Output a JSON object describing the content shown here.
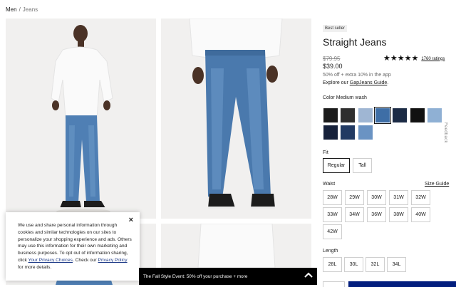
{
  "breadcrumb": {
    "parent": "Men",
    "separator": "/",
    "current": "Jeans"
  },
  "cookie_banner": {
    "text_before": "We use and share personal information through cookies and similar technologies on our sites to personalize your shopping experience and ads. Others may use this information for their own marketing and business purposes. To opt out of information sharing, click ",
    "link1": "Your Privacy Choices",
    "text_middle": ". Check our ",
    "link2": "Privacy Policy",
    "text_after": " for more details.",
    "close": "×"
  },
  "promo": {
    "text": "The Fall Style Event: 50% off your purchase + more"
  },
  "product": {
    "badge": "Best seller",
    "title": "Straight Jeans",
    "old_price": "$79.95",
    "price": "$39.00",
    "rating_stars": "★★★★★",
    "rating_value": 5,
    "ratings_count": "1760 ratings",
    "offer": "50% off + extra 10% in the app",
    "guide_prefix": "Explore our ",
    "guide_link": "GapJeans Guide",
    "guide_suffix": "."
  },
  "color": {
    "label": "Color",
    "selected_name": "Medium wash",
    "swatches": [
      "#1b1b1b",
      "#2e2e2e",
      "#9fb6d3",
      "#3e6ea6",
      "#1c2b45",
      "#111111",
      "#8fb0d4",
      "#16213a",
      "#213a63",
      "#6a93c3"
    ],
    "selected_index": 3
  },
  "fit": {
    "label": "Fit",
    "options": [
      "Regular",
      "Tall"
    ],
    "selected": "Regular"
  },
  "waist": {
    "label": "Waist",
    "size_guide": "Size Guide",
    "options": [
      "28W",
      "29W",
      "30W",
      "31W",
      "32W",
      "33W",
      "34W",
      "36W",
      "38W",
      "40W",
      "42W"
    ]
  },
  "length": {
    "label": "Length",
    "options": [
      "28L",
      "30L",
      "32L",
      "34L"
    ]
  },
  "feedback": "Feedback",
  "colors": {
    "brand_navy": "#031e7e",
    "promo_bg": "#000000",
    "photo_bg": "#f1f0ef"
  }
}
